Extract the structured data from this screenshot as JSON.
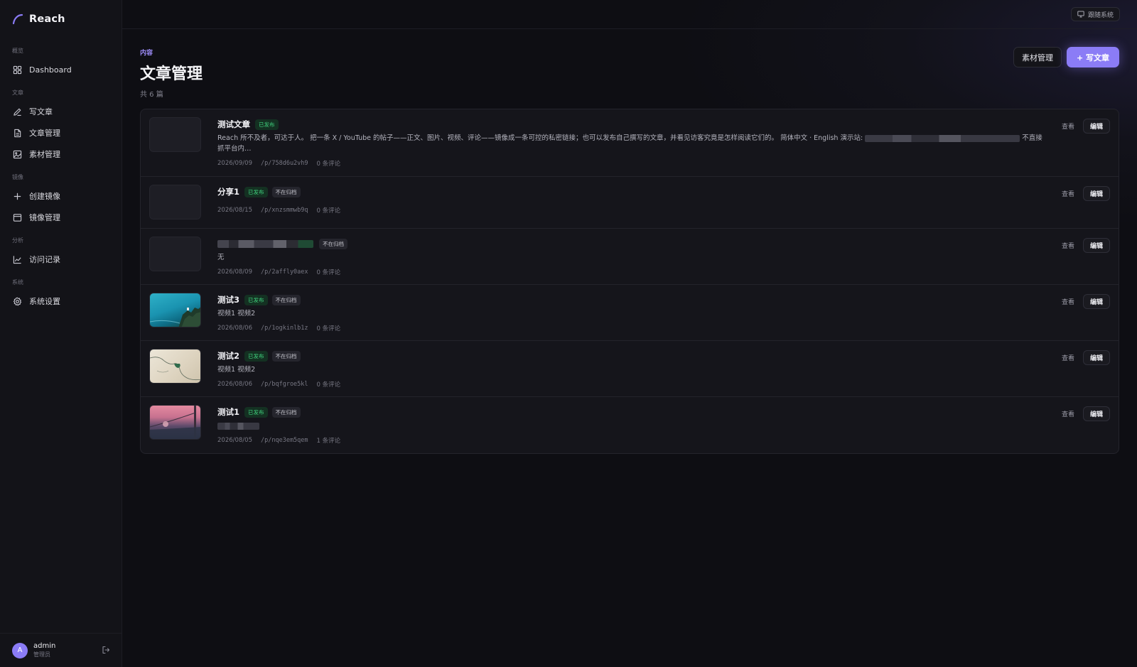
{
  "brand": {
    "name": "Reach"
  },
  "sidebar": {
    "sections": [
      {
        "label": "概览",
        "items": [
          {
            "label": "Dashboard",
            "icon": "grid-icon"
          }
        ]
      },
      {
        "label": "文章",
        "items": [
          {
            "label": "写文章",
            "icon": "pen-icon"
          },
          {
            "label": "文章管理",
            "icon": "document-icon"
          },
          {
            "label": "素材管理",
            "icon": "image-icon"
          }
        ]
      },
      {
        "label": "镜像",
        "items": [
          {
            "label": "创建镜像",
            "icon": "plus-icon"
          },
          {
            "label": "镜像管理",
            "icon": "window-icon"
          }
        ]
      },
      {
        "label": "分析",
        "items": [
          {
            "label": "访问记录",
            "icon": "line-chart-icon"
          }
        ]
      },
      {
        "label": "系统",
        "items": [
          {
            "label": "系统设置",
            "icon": "gear-icon"
          }
        ]
      }
    ]
  },
  "user": {
    "initial": "A",
    "name": "admin",
    "role": "管理员"
  },
  "topbar": {
    "theme_label": "跟随系统"
  },
  "header": {
    "eyebrow": "内容",
    "title": "文章管理",
    "count": "共 6 篇",
    "materials_button": "素材管理",
    "write_button": "+ 写文章"
  },
  "row_actions": {
    "view": "查看",
    "edit": "编辑"
  },
  "posts": [
    {
      "title": "测试文章",
      "published": "已发布",
      "archive": "",
      "excerpt_a": "Reach 所不及者，可达于人。 把一条 X / YouTube 的帖子——正文、图片、视频、评论——镜像成一条可控的私密链接；也可以发布自己撰写的文章，并看见访客究竟是怎样阅读它们的。 简体中文 · English 演示站:",
      "excerpt_b": "不直接抓平台内…",
      "date": "2026/09/09",
      "path": "/p/758d6u2vh9",
      "comments": "0 条评论"
    },
    {
      "title": "分享1",
      "published": "已发布",
      "archive": "不在归档",
      "excerpt_a": "",
      "excerpt_b": "",
      "date": "2026/08/15",
      "path": "/p/xnzsmmwb9q",
      "comments": "0 条评论"
    },
    {
      "title": "",
      "published": "",
      "archive": "不在归档",
      "excerpt_a": "无",
      "excerpt_b": "",
      "date": "2026/08/09",
      "path": "/p/2affly0aex",
      "comments": "0 条评论"
    },
    {
      "title": "测试3",
      "published": "已发布",
      "archive": "不在归档",
      "excerpt_a": "视频1 视频2",
      "excerpt_b": "",
      "date": "2026/08/06",
      "path": "/p/1ogkinlb1z",
      "comments": "0 条评论"
    },
    {
      "title": "测试2",
      "published": "已发布",
      "archive": "不在归档",
      "excerpt_a": "视频1 视频2",
      "excerpt_b": "",
      "date": "2026/08/06",
      "path": "/p/bqfgroe5kl",
      "comments": "0 条评论"
    },
    {
      "title": "测试1",
      "published": "已发布",
      "archive": "不在归档",
      "excerpt_a": "",
      "excerpt_b": "",
      "date": "2026/08/05",
      "path": "/p/nqe3em5qem",
      "comments": "1 条评论"
    }
  ],
  "colors": {
    "accent": "#8b7cf6",
    "published_text": "#3fce7c",
    "background": "#0e0e13"
  }
}
